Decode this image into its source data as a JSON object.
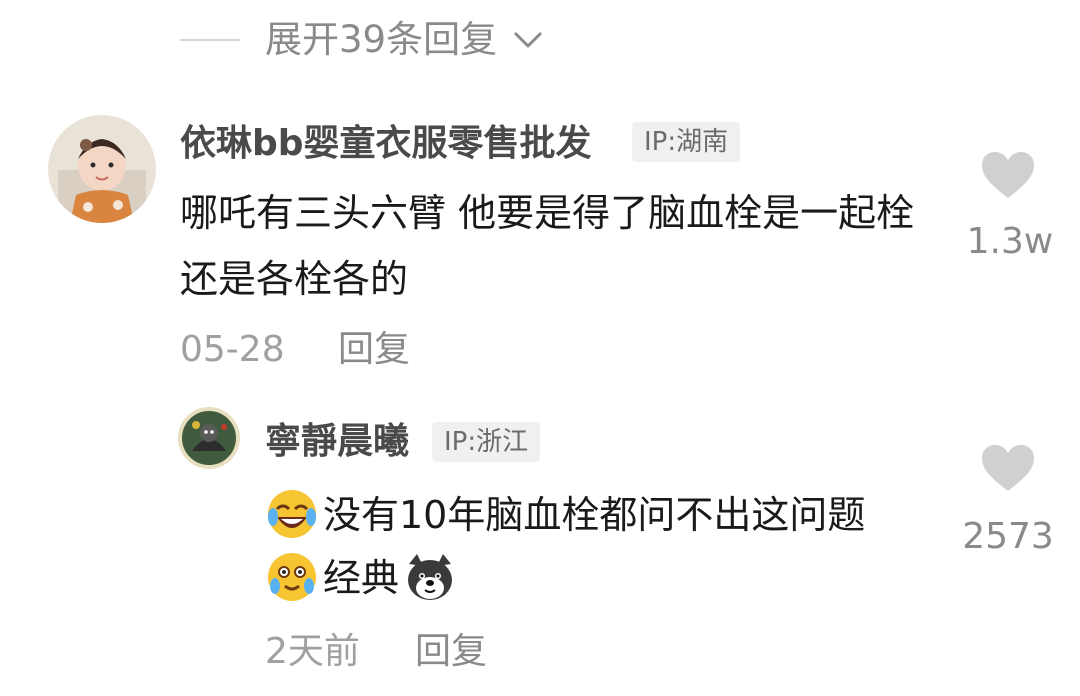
{
  "expand": {
    "label": "展开39条回复"
  },
  "comments": [
    {
      "username": "依琳bb婴童衣服零售批发",
      "ip": "IP:湖南",
      "text": "哪吒有三头六臂 他要是得了脑血栓是一起栓还是各栓各的",
      "date": "05-28",
      "reply_label": "回复",
      "likes": "1.3w"
    },
    {
      "username": "寧靜晨曦",
      "ip": "IP:浙江",
      "text_line1": "没有10年脑血栓都问不出这问题",
      "text_line2": "经典",
      "date": "2天前",
      "reply_label": "回复",
      "likes": "2573"
    }
  ],
  "icons": {
    "expand": "chevron-down-icon",
    "like": "heart-icon",
    "emoji_1": "laughing-crying-emoji",
    "emoji_2": "tears-of-joy-emoji",
    "emoji_3": "dog-doge-emoji"
  },
  "colors": {
    "username": "#4a4a4a",
    "text": "#1a1a1a",
    "meta": "#a0a0a0",
    "heart": "#d0d0d0",
    "badge_bg": "#f0f0f0"
  }
}
